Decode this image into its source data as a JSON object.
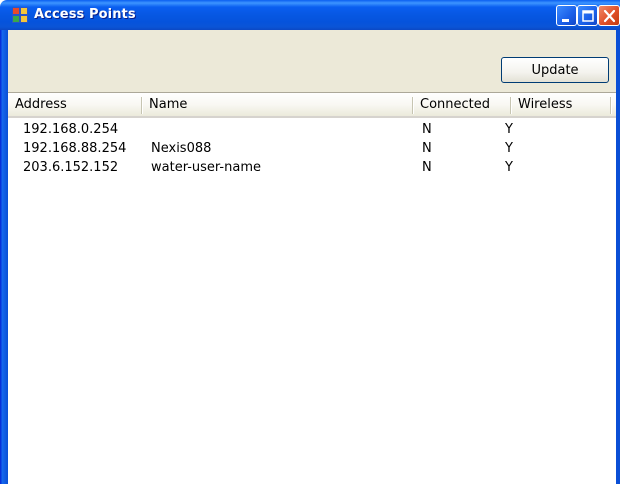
{
  "window": {
    "title": "Access Points",
    "controls": {
      "minimize_icon": "minimize-icon",
      "maximize_icon": "maximize-icon",
      "close_icon": "close-icon"
    },
    "colors": {
      "titlebar": "#0553dc",
      "frame": "#0a4fd6",
      "toolbar": "#ece9d8",
      "close": "#e0502a"
    }
  },
  "toolbar": {
    "update_label": "Update"
  },
  "list": {
    "columns": [
      "Address",
      "Name",
      "Connected",
      "Wireless"
    ],
    "rows": [
      {
        "address": "192.168.0.254",
        "name": "",
        "connected": "N",
        "wireless": "Y"
      },
      {
        "address": "192.168.88.254",
        "name": "Nexis088",
        "connected": "N",
        "wireless": "Y"
      },
      {
        "address": "203.6.152.152",
        "name": "water-user-name",
        "connected": "N",
        "wireless": "Y"
      }
    ]
  }
}
